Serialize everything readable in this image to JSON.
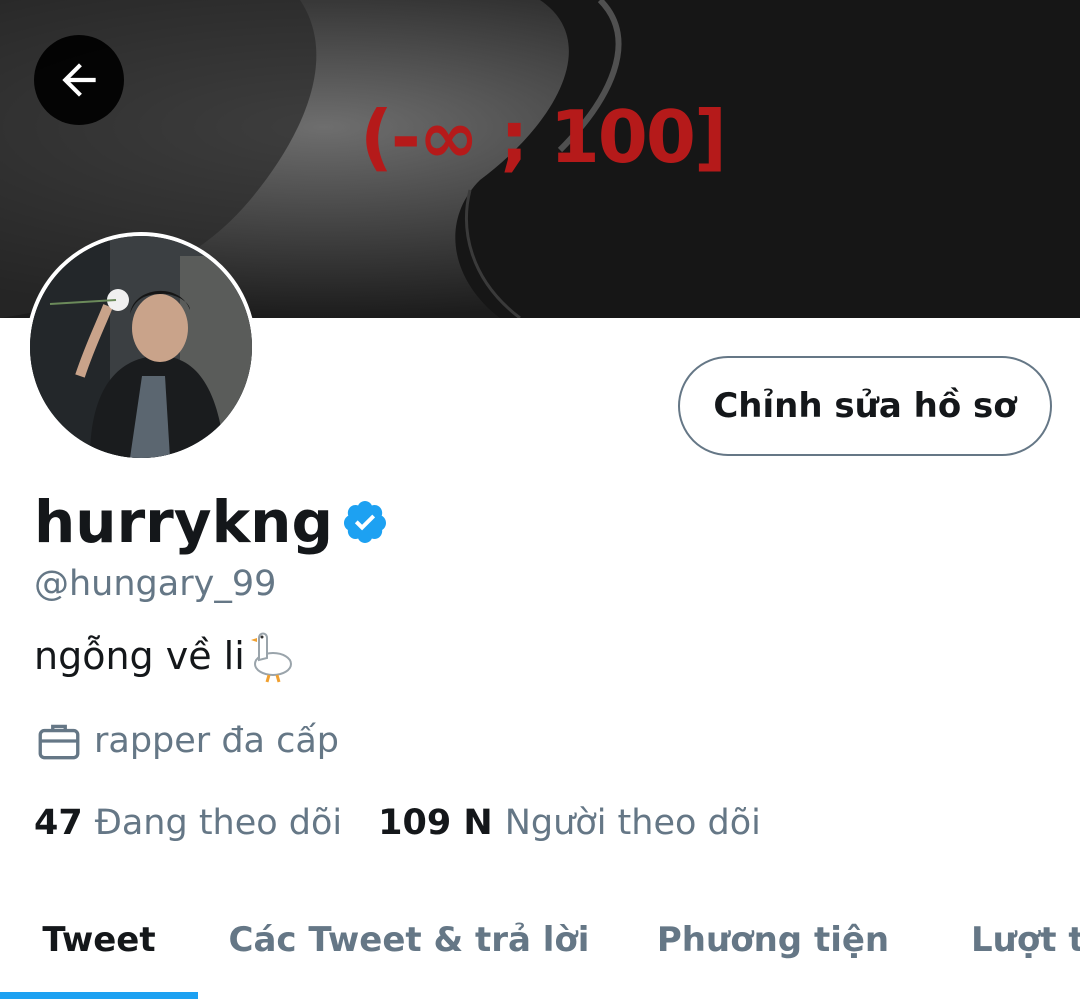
{
  "header": {
    "banner_text": "(-∞ ; 100]",
    "back_icon": "arrow-left-icon"
  },
  "profile": {
    "display_name": "hurrykng",
    "verified_icon": "verified-badge-icon",
    "handle": "@hungary_99",
    "bio": "ngỗng về li",
    "bio_emoji": "goose-emoji",
    "profession_icon": "briefcase-icon",
    "profession": "rapper đa cấp",
    "edit_button_label": "Chỉnh sửa hồ sơ"
  },
  "stats": {
    "following_count": "47",
    "following_label": "Đang theo dõi",
    "followers_count": "109 N",
    "followers_label": "Người theo dõi"
  },
  "tabs": [
    {
      "label": "Tweet",
      "active": true
    },
    {
      "label": "Các Tweet & trả lời",
      "active": false
    },
    {
      "label": "Phương tiện",
      "active": false
    },
    {
      "label": "Lượt thích",
      "active": false
    }
  ],
  "colors": {
    "accent": "#1da1f2",
    "text_primary": "#14171a",
    "text_secondary": "#657786",
    "banner_red": "#b51a1a"
  }
}
